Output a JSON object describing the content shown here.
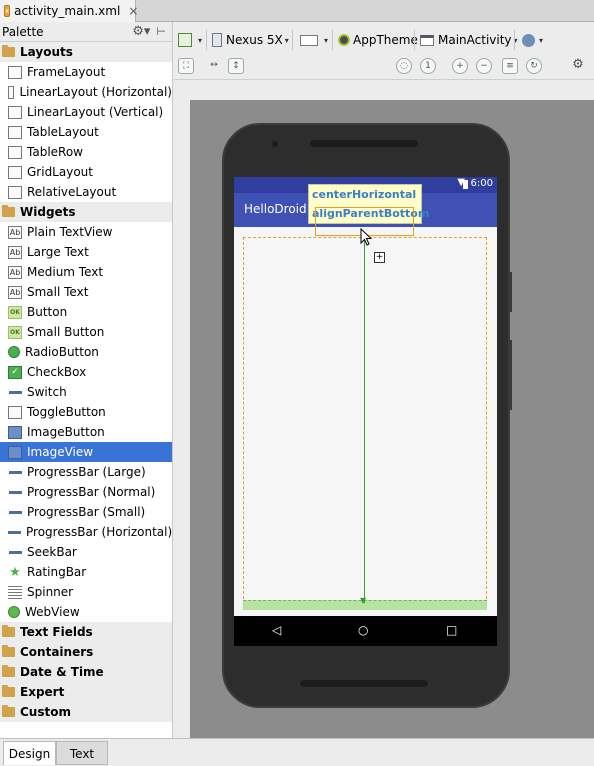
{
  "file_tab": {
    "label": "activity_main.xml",
    "close": "×"
  },
  "palette": {
    "title": "Palette",
    "groups": [
      {
        "label": "Layouts",
        "items": [
          {
            "label": "FrameLayout",
            "icon": "frame-layout-icon"
          },
          {
            "label": "LinearLayout (Horizontal)",
            "icon": "linear-horizontal-icon"
          },
          {
            "label": "LinearLayout (Vertical)",
            "icon": "linear-vertical-icon"
          },
          {
            "label": "TableLayout",
            "icon": "table-layout-icon"
          },
          {
            "label": "TableRow",
            "icon": "table-row-icon"
          },
          {
            "label": "GridLayout",
            "icon": "grid-layout-icon"
          },
          {
            "label": "RelativeLayout",
            "icon": "relative-layout-icon"
          }
        ]
      },
      {
        "label": "Widgets",
        "items": [
          {
            "label": "Plain TextView",
            "icon": "textview-icon"
          },
          {
            "label": "Large Text",
            "icon": "textview-icon"
          },
          {
            "label": "Medium Text",
            "icon": "textview-icon"
          },
          {
            "label": "Small Text",
            "icon": "textview-icon"
          },
          {
            "label": "Button",
            "icon": "button-icon"
          },
          {
            "label": "Small Button",
            "icon": "button-icon"
          },
          {
            "label": "RadioButton",
            "icon": "radio-icon"
          },
          {
            "label": "CheckBox",
            "icon": "checkbox-icon"
          },
          {
            "label": "Switch",
            "icon": "switch-icon"
          },
          {
            "label": "ToggleButton",
            "icon": "toggle-icon"
          },
          {
            "label": "ImageButton",
            "icon": "image-button-icon"
          },
          {
            "label": "ImageView",
            "icon": "image-view-icon",
            "selected": true
          },
          {
            "label": "ProgressBar (Large)",
            "icon": "progressbar-icon"
          },
          {
            "label": "ProgressBar (Normal)",
            "icon": "progressbar-icon"
          },
          {
            "label": "ProgressBar (Small)",
            "icon": "progressbar-icon"
          },
          {
            "label": "ProgressBar (Horizontal)",
            "icon": "progressbar-icon"
          },
          {
            "label": "SeekBar",
            "icon": "seekbar-icon"
          },
          {
            "label": "RatingBar",
            "icon": "star-icon"
          },
          {
            "label": "Spinner",
            "icon": "spinner-icon"
          },
          {
            "label": "WebView",
            "icon": "globe-icon"
          }
        ]
      },
      {
        "label": "Text Fields",
        "items": []
      },
      {
        "label": "Containers",
        "items": []
      },
      {
        "label": "Date & Time",
        "items": []
      },
      {
        "label": "Expert",
        "items": []
      },
      {
        "label": "Custom",
        "items": []
      }
    ]
  },
  "toolbar": {
    "device": "Nexus 5X",
    "theme": "AppTheme",
    "activity": "MainActivity"
  },
  "device_preview": {
    "time": "6:00",
    "app_title": "HelloDroid",
    "tooltip_line1": "centerHorizontal",
    "tooltip_line2": "alignParentBottom",
    "plus": "+"
  },
  "bottom_tabs": {
    "design": "Design",
    "text": "Text"
  },
  "colors": {
    "selection": "#3a73d8",
    "app_bar": "#3f51b5",
    "status_bar": "#303f9f",
    "guide": "#32a332",
    "dashed_bounds": "#e6a024"
  }
}
